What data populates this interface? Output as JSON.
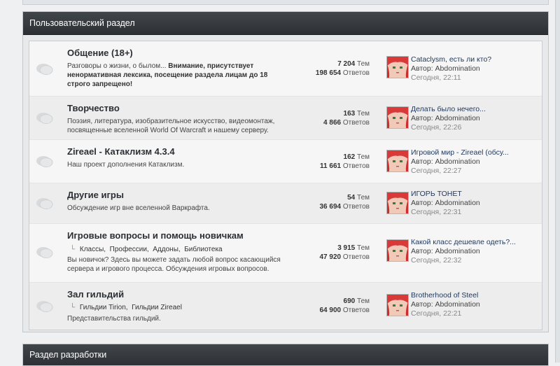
{
  "category": {
    "title": "Пользовательский раздел"
  },
  "category2": {
    "title": "Раздел разработки"
  },
  "forums": [
    {
      "title": "Общение (18+)",
      "desc_plain": "Разговоры о жизни, о былом... ",
      "desc_bold": "Внимание, присутствует ненормативная лексика, посещение раздела лицам до 18 строго запрещено!",
      "topics": "7 204",
      "posts": "198 654",
      "last_title": "Cataclysm, есть ли кто?",
      "last_author": "Автор: Abdomination",
      "last_date": "Сегодня, 22:11"
    },
    {
      "title": "Творчество",
      "desc_plain": "Поэзия, литература, изобразительное искусство, видеомонтаж, посвященные вселенной World Of Warcraft и нашему серверу.",
      "topics": "163",
      "posts": "4 866",
      "last_title": "Делать было нечего...",
      "last_author": "Автор: Abdomination",
      "last_date": "Сегодня, 22:26"
    },
    {
      "title": "Zireael - Катаклизм 4.3.4",
      "desc_plain": "Наш проект дополнения Катаклизм.",
      "topics": "162",
      "posts": "11 661",
      "last_title": "Игровой мир - Zireael (обсу...",
      "last_author": "Автор: Abdomination",
      "last_date": "Сегодня, 22:27"
    },
    {
      "title": "Другие игры",
      "desc_plain": "Обсуждение игр вне вселенной Варкрафта.",
      "topics": "54",
      "posts": "36 694",
      "last_title": "ИГОРЬ ТОНЕТ",
      "last_author": "Автор: Abdomination",
      "last_date": "Сегодня, 22:31"
    },
    {
      "title": "Игровые вопросы и помощь новичкам",
      "subforums": [
        "Классы",
        "Профессии",
        "Аддоны",
        "Библиотека"
      ],
      "desc_plain": "Вы новичок? Здесь вы можете задать любой вопрос касающийся сервера и игрового процесса. Обсуждения игровых вопросов.",
      "topics": "3 915",
      "posts": "47 920",
      "last_title": "Какой класс дешевле одеть?...",
      "last_author": "Автор: Abdomination",
      "last_date": "Сегодня, 22:32"
    },
    {
      "title": "Зал гильдий",
      "subforums": [
        "Гильдии Tirion",
        "Гильдии Zireael"
      ],
      "desc_plain": "Представительства гильдий.",
      "topics": "690",
      "posts": "64 900",
      "last_title": "Brotherhood of Steel",
      "last_author": "Автор: Abdomination",
      "last_date": "Сегодня, 22:21"
    }
  ],
  "labels": {
    "topics_suffix": "Тем",
    "posts_suffix": "Ответов"
  },
  "icons": {
    "forum": "forum-bubble-icon",
    "subforum_arrow": "subforum-arrow-icon"
  },
  "colors": {
    "header_bg": "#35393d",
    "link": "#223a5e"
  }
}
